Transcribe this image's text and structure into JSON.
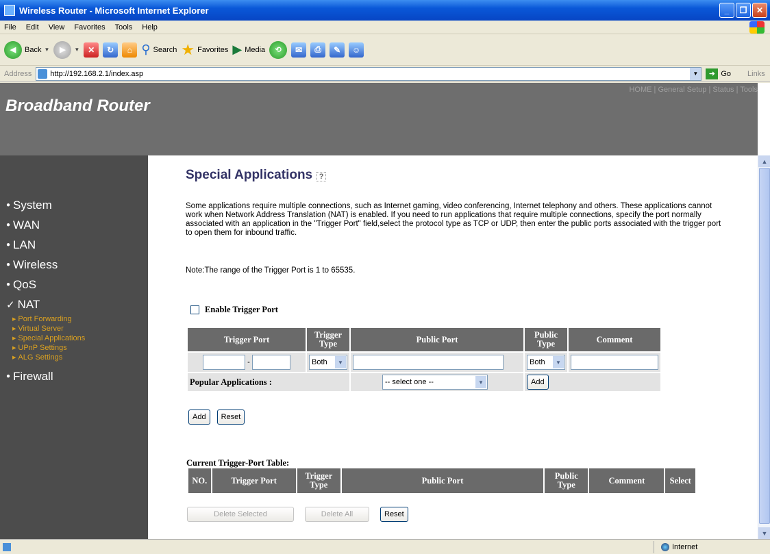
{
  "window": {
    "title": "Wireless Router - Microsoft Internet Explorer"
  },
  "menu": [
    "File",
    "Edit",
    "View",
    "Favorites",
    "Tools",
    "Help"
  ],
  "toolbar": {
    "back": "Back",
    "search": "Search",
    "favorites": "Favorites",
    "media": "Media"
  },
  "address": {
    "label": "Address",
    "url": "http://192.168.2.1/index.asp",
    "go": "Go",
    "links": "Links"
  },
  "header": {
    "brand": "Broadband Router",
    "topnav": "HOME | General Setup | Status | Tools"
  },
  "sidebar": {
    "items": [
      {
        "label": "System",
        "bullet": "●"
      },
      {
        "label": "WAN",
        "bullet": "●"
      },
      {
        "label": "LAN",
        "bullet": "●"
      },
      {
        "label": "Wireless",
        "bullet": "●"
      },
      {
        "label": "QoS",
        "bullet": "●"
      },
      {
        "label": "NAT",
        "bullet": "✓"
      }
    ],
    "subitems": [
      "Port Forwarding",
      "Virtual Server",
      "Special Applications",
      "UPnP Settings",
      "ALG Settings"
    ],
    "firewall": {
      "label": "Firewall",
      "bullet": "●"
    }
  },
  "content": {
    "title": "Special Applications",
    "description": "Some applications require multiple connections, such as Internet gaming, video conferencing, Internet telephony and others. These applications cannot work when Network Address Translation (NAT) is enabled. If you need to run applications that require multiple connections, specify the port normally associated with an application in the \"Trigger Port\" field,select the protocol type as TCP or UDP, then enter the public ports associated with the trigger port to open them for inbound traffic.",
    "note": "Note:The range of the Trigger Port is 1 to 65535.",
    "enable_label": "Enable Trigger Port",
    "table": {
      "headers": [
        "Trigger Port",
        "Trigger Type",
        "Public Port",
        "Public Type",
        "Comment"
      ],
      "port_sep": "-",
      "trigger_type_value": "Both",
      "public_type_value": "Both"
    },
    "popular": {
      "label": "Popular Applications :",
      "select_value": "-- select one --",
      "add": "Add"
    },
    "form_buttons": {
      "add": "Add",
      "reset": "Reset"
    },
    "current_table": {
      "title": "Current Trigger-Port Table:",
      "headers": [
        "NO.",
        "Trigger Port",
        "Trigger Type",
        "Public Port",
        "Public Type",
        "Comment",
        "Select"
      ]
    },
    "bottom_buttons": {
      "delete_selected": "Delete Selected",
      "delete_all": "Delete All",
      "reset": "Reset"
    }
  },
  "status": {
    "zone": "Internet"
  }
}
